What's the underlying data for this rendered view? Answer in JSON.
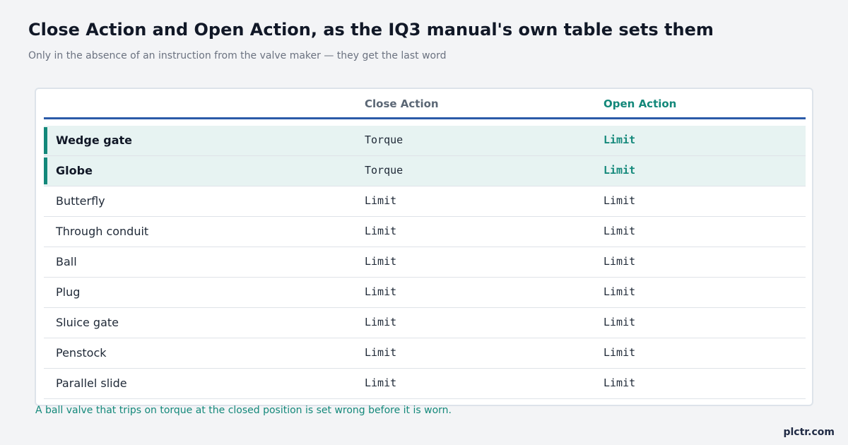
{
  "header": {
    "title": "Close Action and Open Action, as the IQ3 manual's own table sets them",
    "subtitle": "Only in the absence of an instruction from the valve maker — they get the last word"
  },
  "table": {
    "columns": [
      "",
      "Close Action",
      "Open Action"
    ],
    "rows": [
      {
        "valve": "Wedge gate",
        "close": "Torque",
        "open": "Limit",
        "highlighted": true
      },
      {
        "valve": "Globe",
        "close": "Torque",
        "open": "Limit",
        "highlighted": true
      },
      {
        "valve": "Butterfly",
        "close": "Limit",
        "open": "Limit",
        "highlighted": false
      },
      {
        "valve": "Through conduit",
        "close": "Limit",
        "open": "Limit",
        "highlighted": false
      },
      {
        "valve": "Ball",
        "close": "Limit",
        "open": "Limit",
        "highlighted": false
      },
      {
        "valve": "Plug",
        "close": "Limit",
        "open": "Limit",
        "highlighted": false
      },
      {
        "valve": "Sluice gate",
        "close": "Limit",
        "open": "Limit",
        "highlighted": false
      },
      {
        "valve": "Penstock",
        "close": "Limit",
        "open": "Limit",
        "highlighted": false
      },
      {
        "valve": "Parallel slide",
        "close": "Limit",
        "open": "Limit",
        "highlighted": false
      }
    ]
  },
  "footnote": "A ball valve that trips on torque at the closed position is set wrong before it is worn.",
  "brand": "plctr.com",
  "colors": {
    "accent": "#13887a",
    "header_rule": "#2b5ba8",
    "highlight_bg": "#e7f3f2"
  }
}
